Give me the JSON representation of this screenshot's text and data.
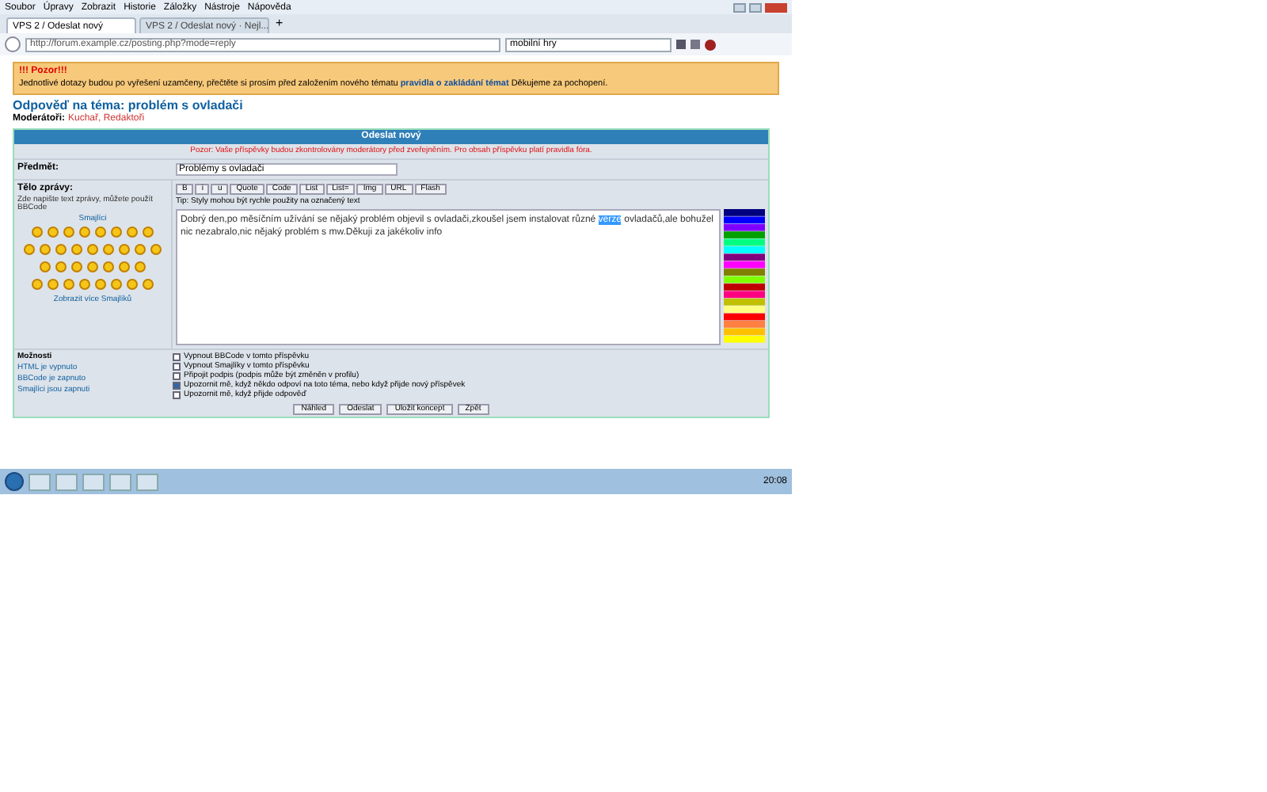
{
  "menu": [
    "Soubor",
    "Úpravy",
    "Zobrazit",
    "Historie",
    "Záložky",
    "Nástroje",
    "Nápověda"
  ],
  "tabs": [
    {
      "label": "VPS 2 / Odeslat nový",
      "selected": true
    },
    {
      "label": "VPS 2 / Odeslat nový · Nejl...",
      "selected": false
    }
  ],
  "new_tab": "+",
  "address": {
    "value": "http://forum.example.cz/posting.php?mode=reply"
  },
  "search": {
    "value": "mobilní hry"
  },
  "notice": {
    "title": "!!! Pozor!!!",
    "text": "Jednotlivé dotazy budou po vyřešení uzamčeny, přečtěte si prosím před založením nového tématu",
    "link": "pravidla o zakládání témat",
    "after": "Děkujeme za pochopení."
  },
  "topic": {
    "title": "Odpověď na téma: problém s ovladači",
    "moderators_label": "Moderátoři:",
    "moderators": "Kuchař, Redaktoři"
  },
  "form": {
    "header": "Odeslat nový",
    "warning": "Pozor: Vaše příspěvky budou zkontrolovány moderátory před zveřejněním. Pro obsah příspěvku platí pravidla fóra.",
    "subject_label": "Předmět:",
    "subject": "Problémy s ovladači",
    "body_label": "Tělo zprávy:",
    "body_hint": "Zde napište text zprávy, můžete použít BBCode",
    "smilies_label": "Smajlíci",
    "more_smilies": "Zobrazit více Smajlíků",
    "toolbar": [
      "B",
      "i",
      "u",
      "Quote",
      "Code",
      "List",
      "List=",
      "Img",
      "URL",
      "Flash"
    ],
    "hint": "Tip: Styly mohou být rychle použity na označený text",
    "message_before": "Dobrý den,po měsíčním užívání se nějaký problém objevil s ovladači,zkoušel jsem instalovat různé ",
    "message_selected": "verze",
    "message_after": " ovladačů,ale bohužel nic nezabralo,nic nějaký problém s mw.Děkuji za jakékoliv info",
    "options_label": "Možnosti",
    "option_lines": [
      "HTML je vypnuto",
      "BBCode je zapnuto",
      "Smajlíci jsou zapnuti"
    ],
    "options": [
      {
        "label": "Vypnout BBCode v tomto příspěvku",
        "checked": false
      },
      {
        "label": "Vypnout Smajlíky v tomto příspěvku",
        "checked": false
      },
      {
        "label": "Připojit podpis (podpis může být změněn v profilu)",
        "checked": false
      },
      {
        "label": "Upozornit mě, když někdo odpoví na toto téma, nebo když přijde nový příspěvek",
        "checked": true
      },
      {
        "label": "Upozornit mě, když přijde odpověď",
        "checked": false
      }
    ],
    "buttons": [
      "Náhled",
      "Odeslat",
      "Uložit koncept",
      "Zpět"
    ]
  },
  "taskbar": {
    "time": "20:08"
  }
}
